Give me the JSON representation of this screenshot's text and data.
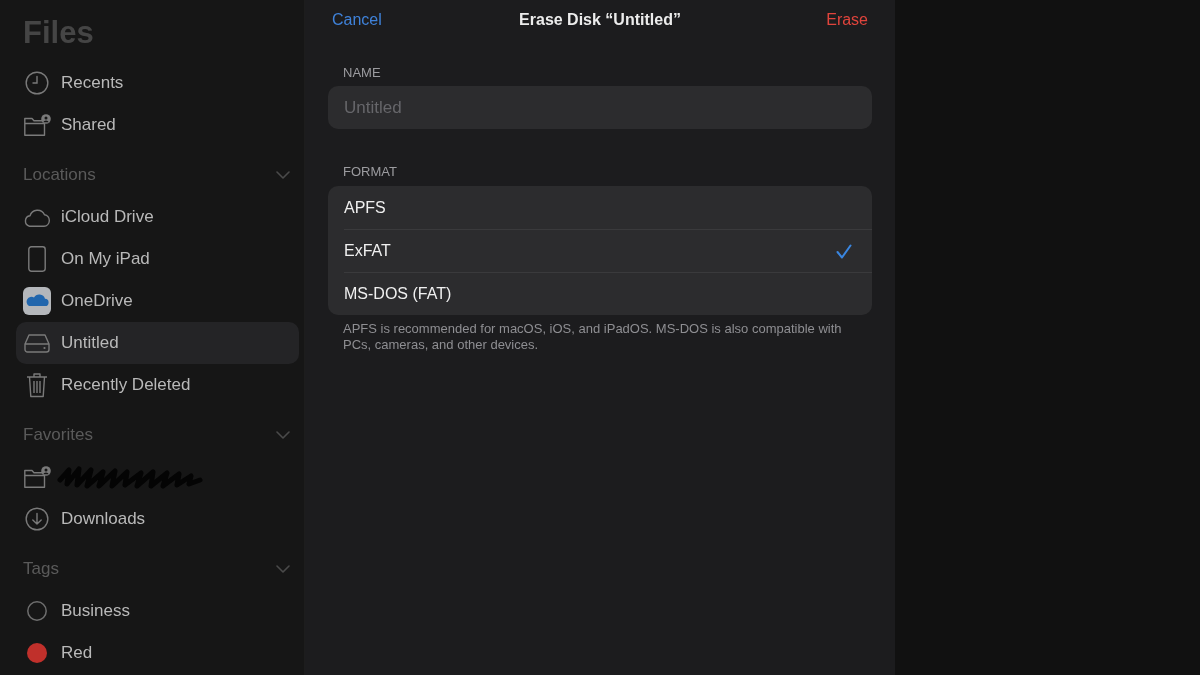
{
  "sidebar": {
    "title": "Files",
    "items": [
      {
        "label": "Recents",
        "selected": false
      },
      {
        "label": "Shared",
        "selected": false
      }
    ],
    "sections": [
      {
        "title": "Locations",
        "expanded": true,
        "items": [
          {
            "label": "iCloud Drive",
            "selected": false
          },
          {
            "label": "On My iPad",
            "selected": false
          },
          {
            "label": "OneDrive",
            "selected": false
          },
          {
            "label": "Untitled",
            "selected": true
          },
          {
            "label": "Recently Deleted",
            "selected": false
          }
        ]
      },
      {
        "title": "Favorites",
        "expanded": true,
        "items": [
          {
            "redacted": true,
            "selected": false
          },
          {
            "label": "Downloads",
            "redacted": false,
            "selected": false
          }
        ]
      },
      {
        "title": "Tags",
        "expanded": true,
        "items": [
          {
            "label": "Business",
            "color": "#6e6e6e",
            "filled": false,
            "selected": false
          },
          {
            "label": "Red",
            "color": "#c0302b",
            "filled": true,
            "selected": false
          }
        ]
      }
    ]
  },
  "dialog": {
    "cancel": "Cancel",
    "title": "Erase Disk “Untitled”",
    "confirm": "Erase",
    "name_section": {
      "label": "NAME",
      "field": {
        "placeholder": "Untitled"
      }
    },
    "format_section": {
      "label": "FORMAT",
      "options": [
        {
          "label": "APFS",
          "selected": false
        },
        {
          "label": "ExFAT",
          "selected": true
        },
        {
          "label": "MS-DOS (FAT)",
          "selected": false
        }
      ],
      "footer": "APFS is recommended for macOS, iOS, and iPadOS. MS-DOS is also compatible with PCs, cameras, and other devices."
    }
  }
}
